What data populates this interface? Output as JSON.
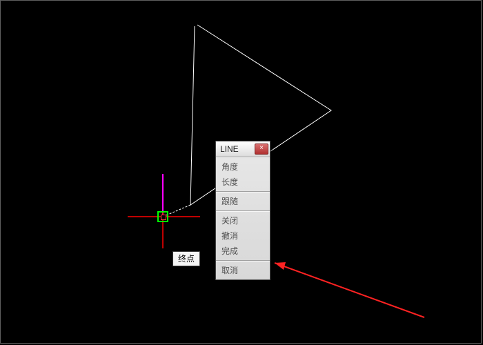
{
  "menu": {
    "title": "LINE",
    "close": "×",
    "group1": [
      "角度",
      "长度"
    ],
    "group2": [
      "跟随"
    ],
    "group3": [
      "关闭",
      "撤消",
      "完成"
    ],
    "group4": [
      "取消"
    ]
  },
  "tooltip": {
    "label": "终点"
  },
  "colors": {
    "snap_box": "#00ff00",
    "crosshair": "#ff0000",
    "magenta_axis": "#ff00ff",
    "line": "#ffffff"
  }
}
